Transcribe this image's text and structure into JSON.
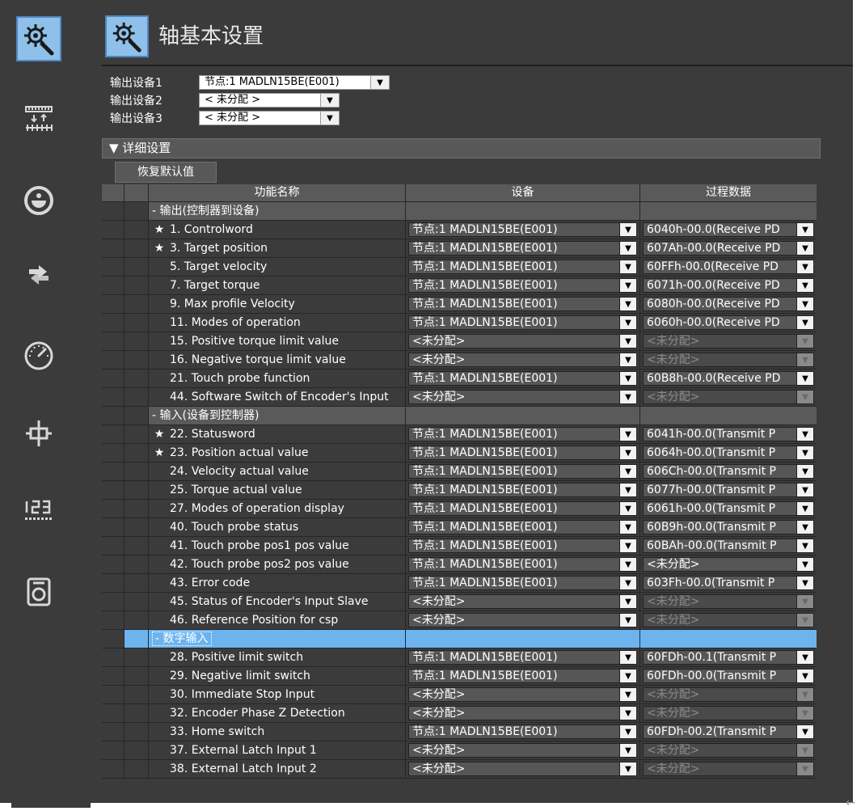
{
  "header": {
    "title": "轴基本设置"
  },
  "devices": [
    {
      "label": "输出设备1",
      "value": "节点:1 MADLN15BE(E001)"
    },
    {
      "label": "输出设备2",
      "value": "< 未分配 >"
    },
    {
      "label": "输出设备3",
      "value": "< 未分配 >"
    }
  ],
  "detail": {
    "label": "▼ 详细设置",
    "reset_label": "恢复默认值"
  },
  "table": {
    "headers": {
      "function": "功能名称",
      "device": "设备",
      "process": "过程数据"
    },
    "rows": [
      {
        "kind": "group",
        "label": "- 输出(控制器到设备)"
      },
      {
        "kind": "item",
        "star": "★",
        "name": "1. Controlword",
        "device": "节点:1 MADLN15BE(E001)",
        "process": "6040h-00.0(Receive PD",
        "pd": false
      },
      {
        "kind": "item",
        "star": "★",
        "name": "3. Target position",
        "device": "节点:1 MADLN15BE(E001)",
        "process": "607Ah-00.0(Receive PD",
        "pd": false
      },
      {
        "kind": "item",
        "star": "",
        "name": "5. Target velocity",
        "device": "节点:1 MADLN15BE(E001)",
        "process": "60FFh-00.0(Receive PD",
        "pd": false
      },
      {
        "kind": "item",
        "star": "",
        "name": "7. Target torque",
        "device": "节点:1 MADLN15BE(E001)",
        "process": "6071h-00.0(Receive PD",
        "pd": false
      },
      {
        "kind": "item",
        "star": "",
        "name": "9. Max profile Velocity",
        "device": "节点:1 MADLN15BE(E001)",
        "process": "6080h-00.0(Receive PD",
        "pd": false
      },
      {
        "kind": "item",
        "star": "",
        "name": "11. Modes of operation",
        "device": "节点:1 MADLN15BE(E001)",
        "process": "6060h-00.0(Receive PD",
        "pd": false
      },
      {
        "kind": "item",
        "star": "",
        "name": "15. Positive torque limit value",
        "device": "<未分配>",
        "process": "<未分配>",
        "pd": true
      },
      {
        "kind": "item",
        "star": "",
        "name": "16. Negative torque limit value",
        "device": "<未分配>",
        "process": "<未分配>",
        "pd": true
      },
      {
        "kind": "item",
        "star": "",
        "name": "21. Touch probe function",
        "device": "节点:1 MADLN15BE(E001)",
        "process": "60B8h-00.0(Receive PD",
        "pd": false
      },
      {
        "kind": "item",
        "star": "",
        "name": "44. Software Switch of Encoder's Input",
        "device": "<未分配>",
        "process": "<未分配>",
        "pd": true
      },
      {
        "kind": "group",
        "label": "- 输入(设备到控制器)"
      },
      {
        "kind": "item",
        "star": "★",
        "name": "22. Statusword",
        "device": "节点:1 MADLN15BE(E001)",
        "process": "6041h-00.0(Transmit P",
        "pd": false
      },
      {
        "kind": "item",
        "star": "★",
        "name": "23. Position actual value",
        "device": "节点:1 MADLN15BE(E001)",
        "process": "6064h-00.0(Transmit P",
        "pd": false
      },
      {
        "kind": "item",
        "star": "",
        "name": "24. Velocity actual value",
        "device": "节点:1 MADLN15BE(E001)",
        "process": "606Ch-00.0(Transmit P",
        "pd": false
      },
      {
        "kind": "item",
        "star": "",
        "name": "25. Torque actual value",
        "device": "节点:1 MADLN15BE(E001)",
        "process": "6077h-00.0(Transmit P",
        "pd": false
      },
      {
        "kind": "item",
        "star": "",
        "name": "27. Modes of operation display",
        "device": "节点:1 MADLN15BE(E001)",
        "process": "6061h-00.0(Transmit P",
        "pd": false
      },
      {
        "kind": "item",
        "star": "",
        "name": "40. Touch probe status",
        "device": "节点:1 MADLN15BE(E001)",
        "process": "60B9h-00.0(Transmit P",
        "pd": false
      },
      {
        "kind": "item",
        "star": "",
        "name": "41. Touch probe pos1 pos value",
        "device": "节点:1 MADLN15BE(E001)",
        "process": "60BAh-00.0(Transmit P",
        "pd": false
      },
      {
        "kind": "item",
        "star": "",
        "name": "42. Touch probe pos2 pos value",
        "device": "节点:1 MADLN15BE(E001)",
        "process": "<未分配>",
        "pd": false
      },
      {
        "kind": "item",
        "star": "",
        "name": "43. Error code",
        "device": "节点:1 MADLN15BE(E001)",
        "process": "603Fh-00.0(Transmit P",
        "pd": false
      },
      {
        "kind": "item",
        "star": "",
        "name": "45. Status of Encoder's Input Slave",
        "device": "<未分配>",
        "process": "<未分配>",
        "pd": true
      },
      {
        "kind": "item",
        "star": "",
        "name": "46. Reference Position for csp",
        "device": "<未分配>",
        "process": "<未分配>",
        "pd": true
      },
      {
        "kind": "group",
        "label": "- 数字输入",
        "selected": true
      },
      {
        "kind": "item",
        "star": "",
        "name": "28. Positive limit switch",
        "device": "节点:1 MADLN15BE(E001)",
        "process": "60FDh-00.1(Transmit P",
        "pd": false
      },
      {
        "kind": "item",
        "star": "",
        "name": "29. Negative limit switch",
        "device": "节点:1 MADLN15BE(E001)",
        "process": "60FDh-00.0(Transmit P",
        "pd": false
      },
      {
        "kind": "item",
        "star": "",
        "name": "30. Immediate Stop Input",
        "device": "<未分配>",
        "process": "<未分配>",
        "pd": true
      },
      {
        "kind": "item",
        "star": "",
        "name": "32. Encoder Phase Z Detection",
        "device": "<未分配>",
        "process": "<未分配>",
        "pd": true
      },
      {
        "kind": "item",
        "star": "",
        "name": "33. Home switch",
        "device": "节点:1 MADLN15BE(E001)",
        "process": "60FDh-00.2(Transmit P",
        "pd": false
      },
      {
        "kind": "item",
        "star": "",
        "name": "37. External Latch Input 1",
        "device": "<未分配>",
        "process": "<未分配>",
        "pd": true
      },
      {
        "kind": "item",
        "star": "",
        "name": "38. External Latch Input 2",
        "device": "<未分配>",
        "process": "<未分配>",
        "pd": true
      }
    ]
  },
  "footer": {
    "corner_arrow": "←"
  },
  "icons": {
    "sidebar": [
      "axis-settings-icon",
      "unit-conversion-icon",
      "operation-icon",
      "other-icon",
      "limit-icon",
      "position-count-icon",
      "servo-drive-icon",
      "homing-icon"
    ]
  },
  "colors": {
    "background": "#3b3b3b",
    "selected": "#6db4ef",
    "active_button": "#8ec0ea"
  }
}
